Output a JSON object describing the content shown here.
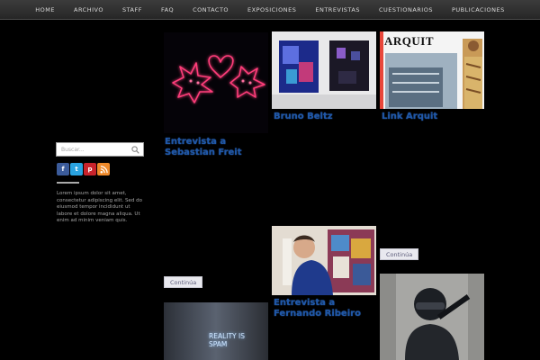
{
  "nav": {
    "items": [
      "HOME",
      "ARCHIVO",
      "STAFF",
      "FAQ",
      "CONTACTO",
      "EXPOSICIONES",
      "ENTREVISTAS",
      "CUESTIONARIOS",
      "PUBLICACIONES"
    ]
  },
  "sidebar": {
    "search_placeholder": "Buscar...",
    "social": [
      "f",
      "t",
      "p",
      "rss"
    ],
    "widget_text": "Lorem ipsum dolor sit amet, consectetur adipiscing elit. Sed do eiusmod tempor incididunt ut labore et dolore magna aliqua. Ut enim ad minim veniam quis."
  },
  "posts": {
    "neon": {
      "title": "Entrevista a Sebastian Freit"
    },
    "gallery": {
      "title": "Bruno Beltz"
    },
    "arquit": {
      "title": "Link Arquit",
      "magazine": "ARQUIT"
    },
    "man": {
      "title": "Entrevista a Fernando Ribeiro"
    },
    "more1": "Continúa",
    "more2": "Continúa",
    "spam": {
      "sign": "REALITY IS SPAM"
    }
  },
  "colors": {
    "nav_bg": "#2f2f2f",
    "link": "#1f57a8",
    "background": "#000000"
  }
}
